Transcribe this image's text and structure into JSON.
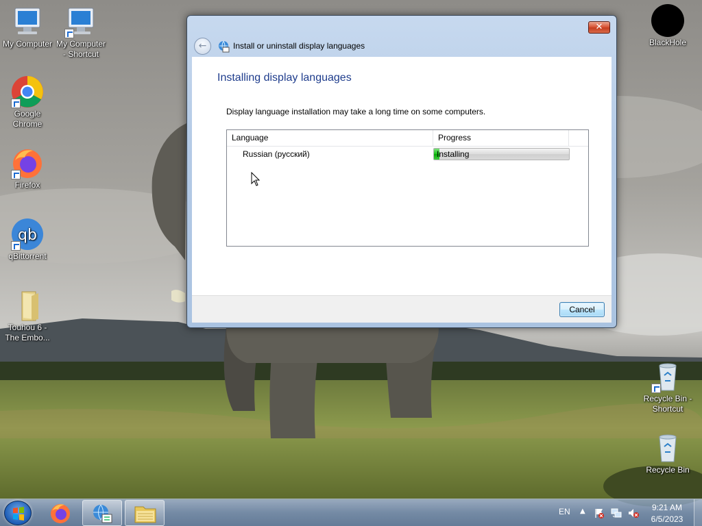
{
  "desktop": {
    "icons": [
      {
        "label": "My Computer",
        "icon": "computer-icon"
      },
      {
        "label": "My Computer\n- Shortcut",
        "icon": "computer-shortcut-icon"
      },
      {
        "label": "Google\nChrome",
        "icon": "chrome-icon"
      },
      {
        "label": "Firefox",
        "icon": "firefox-icon"
      },
      {
        "label": "qBittorrent",
        "icon": "qbittorrent-icon"
      },
      {
        "label": "Touhou 6  -\nThe Embo...",
        "icon": "folder-icon"
      },
      {
        "label": "BlackHole",
        "icon": "blackhole-icon"
      },
      {
        "label": "Recycle Bin -\nShortcut",
        "icon": "recycle-bin-shortcut-icon"
      },
      {
        "label": "Recycle Bin",
        "icon": "recycle-bin-icon"
      }
    ]
  },
  "window": {
    "title": "Install or uninstall display languages",
    "close_label": "✕",
    "heading": "Installing display languages",
    "description": "Display language installation may take a long time on some computers.",
    "list": {
      "columns": [
        "Language",
        "Progress"
      ],
      "rows": [
        {
          "language": "Russian (русский)",
          "status": "Installing",
          "progress": 0.04
        }
      ]
    },
    "cancel_label": "Cancel"
  },
  "taskbar": {
    "language": "EN",
    "chevron": "▲",
    "time": "9:21 AM",
    "date": "6/5/2023",
    "pinned": [
      "firefox-icon",
      "language-settings-icon",
      "file-explorer-icon"
    ]
  },
  "colors": {
    "heading": "#1e3c8c",
    "progress_green": "#18c418",
    "close_red": "#c63f20"
  }
}
